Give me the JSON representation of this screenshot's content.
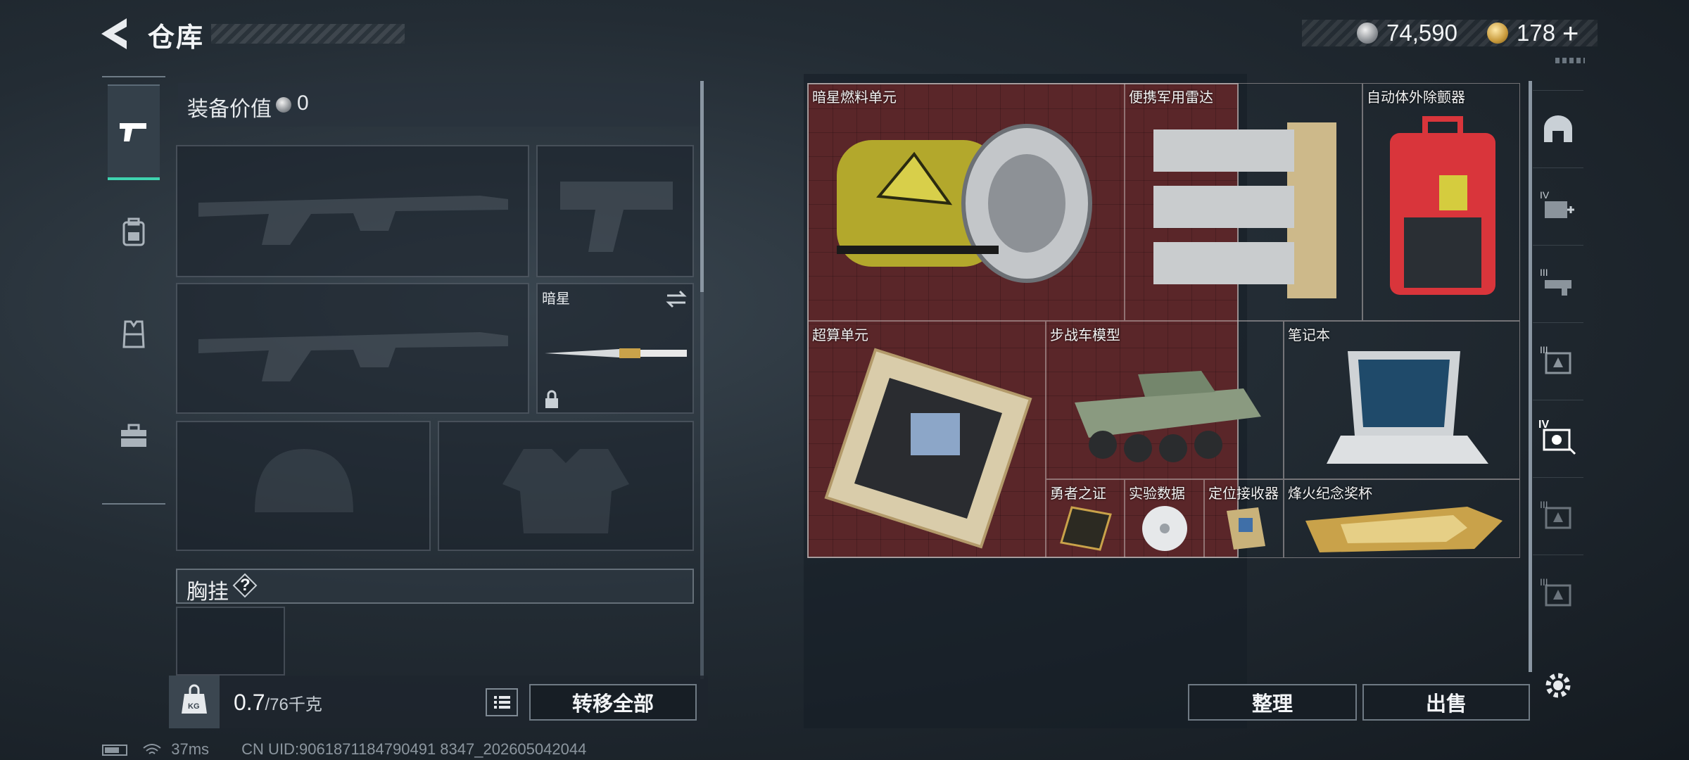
{
  "header": {
    "title": "仓库"
  },
  "currency": {
    "coins": "74,590",
    "premium": "178"
  },
  "left_nav": {
    "items": [
      "weapons",
      "backpack",
      "vest",
      "toolbox"
    ],
    "active": 0
  },
  "loadout": {
    "value_label": "装备价值",
    "value": "0",
    "melee_slot_label": "暗星",
    "chest_rig_label": "胸挂",
    "help_symbol": "?"
  },
  "weight": {
    "current": "0.7",
    "capacity": "/76千克",
    "bag_label": "KG"
  },
  "buttons": {
    "transfer_all": "转移全部",
    "sort": "整理",
    "sell": "出售"
  },
  "stash": {
    "items": [
      {
        "name": "暗星燃料单元"
      },
      {
        "name": "便携军用雷达"
      },
      {
        "name": "自动体外除颤器"
      },
      {
        "name": "超算单元"
      },
      {
        "name": "步战车模型"
      },
      {
        "name": "笔记本"
      },
      {
        "name": "勇者之证"
      },
      {
        "name": "实验数据"
      },
      {
        "name": "定位接收器"
      },
      {
        "name": "烽火纪念奖杯"
      }
    ]
  },
  "right_nav": {
    "tiers": [
      "",
      "IV",
      "III",
      "III",
      "IV",
      "III",
      "III"
    ],
    "active": 4
  },
  "status": {
    "ping": "37ms",
    "uid": "CN UID:9061871184790491 8347_202605042044"
  }
}
